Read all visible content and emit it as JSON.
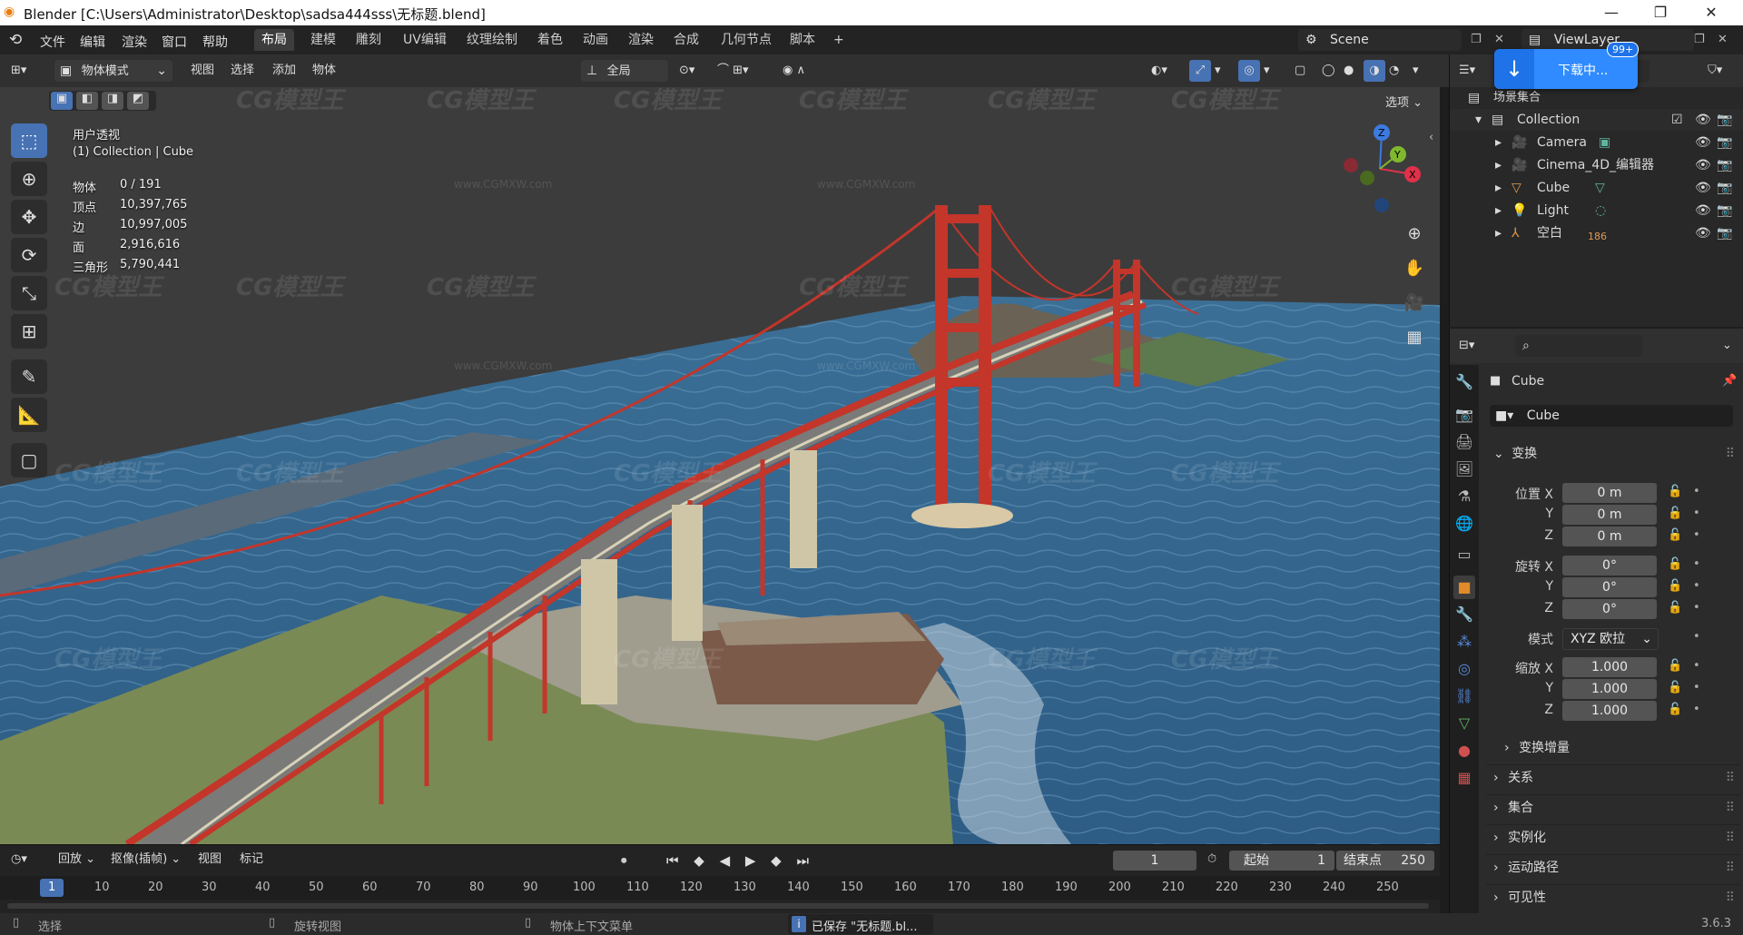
{
  "titlebar": {
    "title": "Blender [C:\\Users\\Administrator\\Desktop\\sadsa444sss\\无标题.blend]",
    "min": "—",
    "restore": "❐",
    "close": "✕"
  },
  "menu": {
    "items": [
      "文件",
      "编辑",
      "渲染",
      "窗口",
      "帮助"
    ],
    "workspaces": [
      "布局",
      "建模",
      "雕刻",
      "UV编辑",
      "纹理绘制",
      "着色",
      "动画",
      "渲染",
      "合成",
      "几何节点",
      "脚本"
    ],
    "add_tab": "+",
    "scene": "Scene",
    "view_layer": "ViewLayer"
  },
  "download": {
    "label": "下载中...",
    "badge": "99+"
  },
  "viewport_header": {
    "mode": "物体模式",
    "menus": [
      "视图",
      "选择",
      "添加",
      "物体"
    ],
    "transform_orientation": "全局",
    "options": "选项"
  },
  "overlay_info": {
    "view_name": "用户透视",
    "collection": "(1) Collection | Cube",
    "stats": [
      {
        "label": "物体",
        "value": "0 / 191"
      },
      {
        "label": "顶点",
        "value": "10,397,765"
      },
      {
        "label": "边",
        "value": "10,997,005"
      },
      {
        "label": "面",
        "value": "2,916,616"
      },
      {
        "label": "三角形",
        "value": "5,790,441"
      }
    ]
  },
  "watermark": {
    "logo": "CG模型王",
    "url": "www.CGMXW.com"
  },
  "timeline": {
    "playback": "回放",
    "keying": "抠像(插帧)",
    "view": "视图",
    "marker": "标记",
    "current_frame": "1",
    "start_label": "起始",
    "start": "1",
    "end_label": "结束点",
    "end": "250",
    "ruler": [
      "1",
      "10",
      "20",
      "30",
      "40",
      "50",
      "60",
      "70",
      "80",
      "90",
      "100",
      "110",
      "120",
      "130",
      "140",
      "150",
      "160",
      "170",
      "180",
      "190",
      "200",
      "210",
      "220",
      "230",
      "240",
      "250"
    ]
  },
  "statusbar": {
    "select": "选择",
    "rotate": "旋转视图",
    "context": "物体上下文菜单",
    "saved": "已保存 \"无标题.bl...",
    "version": "3.6.3"
  },
  "outliner": {
    "root": "场景集合",
    "collection": "Collection",
    "items": [
      {
        "name": "Camera",
        "badge": ""
      },
      {
        "name": "Cinema_4D_编辑器",
        "badge": ""
      },
      {
        "name": "Cube",
        "badge": ""
      },
      {
        "name": "Light",
        "badge": ""
      },
      {
        "name": "空白",
        "badge": "186"
      }
    ]
  },
  "properties": {
    "object_name": "Cube",
    "object_field": "Cube",
    "transform_title": "变换",
    "location": {
      "label_x": "位置 X",
      "label_y": "Y",
      "label_z": "Z",
      "x": "0 m",
      "y": "0 m",
      "z": "0 m"
    },
    "rotation": {
      "label_x": "旋转 X",
      "label_y": "Y",
      "label_z": "Z",
      "x": "0°",
      "y": "0°",
      "z": "0°"
    },
    "mode_label": "模式",
    "mode_value": "XYZ 欧拉",
    "scale": {
      "label_x": "缩放 X",
      "label_y": "Y",
      "label_z": "Z",
      "x": "1.000",
      "y": "1.000",
      "z": "1.000"
    },
    "delta_transform": "变换增量",
    "panels": [
      "关系",
      "集合",
      "实例化",
      "运动路径",
      "可见性"
    ]
  },
  "colors": {
    "accent": "#4772b3",
    "active_frame": "#4772b3",
    "bridge": "#c4352a",
    "water": "#2e5f88"
  }
}
